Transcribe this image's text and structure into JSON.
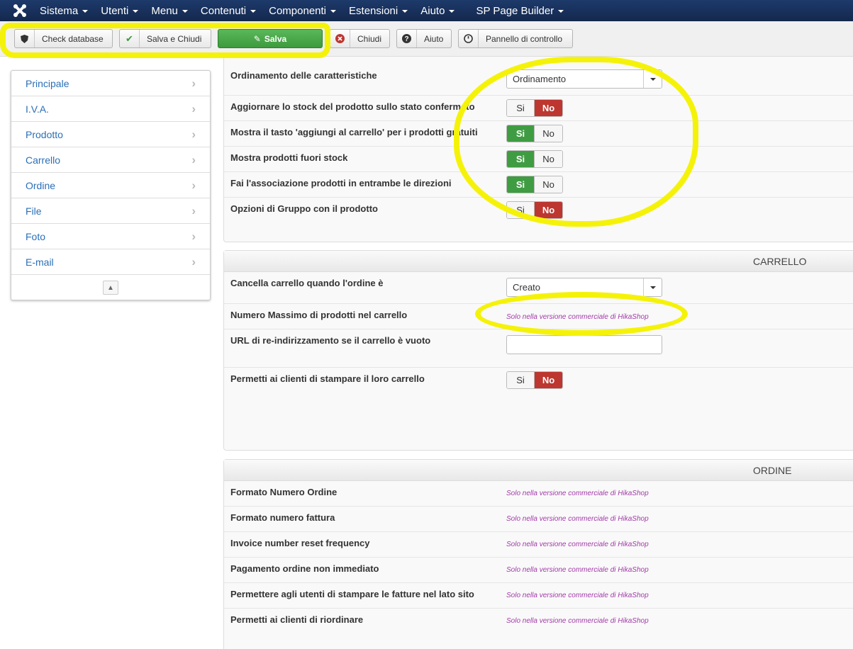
{
  "topnav": {
    "items": [
      {
        "label": "Sistema"
      },
      {
        "label": "Utenti"
      },
      {
        "label": "Menu"
      },
      {
        "label": "Contenuti"
      },
      {
        "label": "Componenti"
      },
      {
        "label": "Estensioni"
      },
      {
        "label": "Aiuto"
      },
      {
        "label": "SP Page Builder"
      }
    ]
  },
  "toolbar": {
    "check_database": "Check database",
    "save_close": "Salva e Chiudi",
    "save": "Salva",
    "close": "Chiudi",
    "help": "Aiuto",
    "control_panel": "Pannello di controllo"
  },
  "sidebar": {
    "items": [
      {
        "label": "Principale"
      },
      {
        "label": "I.V.A."
      },
      {
        "label": "Prodotto"
      },
      {
        "label": "Carrello"
      },
      {
        "label": "Ordine"
      },
      {
        "label": "File"
      },
      {
        "label": "Foto"
      },
      {
        "label": "E-mail"
      }
    ]
  },
  "toggle": {
    "yes": "Si",
    "no": "No"
  },
  "commercial_note": "Solo nella versione commerciale di HikaShop",
  "product_panel": {
    "rows": [
      {
        "label": "Ordinamento delle caratteristiche",
        "value": "Ordinamento"
      },
      {
        "label": "Aggiornare lo stock del prodotto sullo stato confermato",
        "value": "No"
      },
      {
        "label": "Mostra il tasto 'aggiungi al carrello' per i prodotti gratuiti",
        "value": "Si"
      },
      {
        "label": "Mostra prodotti fuori stock",
        "value": "Si"
      },
      {
        "label": "Fai l'associazione prodotti in entrambe le direzioni",
        "value": "Si"
      },
      {
        "label": "Opzioni di Gruppo con il prodotto",
        "value": "No"
      }
    ]
  },
  "cart_panel": {
    "title": "CARRELLO",
    "rows": [
      {
        "label": "Cancella carrello quando l'ordine è",
        "value": "Creato"
      },
      {
        "label": "Numero Massimo di prodotti nel carrello"
      },
      {
        "label": "URL di re-indirizzamento se il carrello è vuoto",
        "value": ""
      },
      {
        "label": "Permetti ai clienti di stampare il loro carrello",
        "value": "No"
      }
    ]
  },
  "order_panel": {
    "title": "ORDINE",
    "rows": [
      {
        "label": "Formato Numero Ordine"
      },
      {
        "label": "Formato numero fattura"
      },
      {
        "label": "Invoice number reset frequency"
      },
      {
        "label": "Pagamento ordine non immediato"
      },
      {
        "label": "Permettere agli utenti di stampare le fatture nel lato sito"
      },
      {
        "label": "Permetti ai clienti di riordinare"
      }
    ]
  },
  "colors": {
    "nav_bg": "#1a3867",
    "link": "#2a6fb7",
    "toggle_yes": "#3f9c42",
    "toggle_no": "#bd362f",
    "commercial": "#a23aa8",
    "highlight": "#f5f20a"
  }
}
